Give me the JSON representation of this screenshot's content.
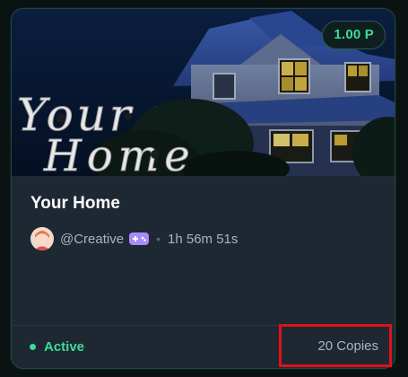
{
  "card": {
    "price": "1.00 P",
    "banner_art_text": "Your Home",
    "title": "Your Home",
    "creator": "@Creative",
    "timer": "1h 56m 51s",
    "separator": "•",
    "status": "Active",
    "copies": "20 Copies"
  },
  "colors": {
    "accent_green": "#3ddc97",
    "card_bg": "#1e2833",
    "highlight_red": "#e0101a",
    "gamepad_purple": "#a78bfa"
  },
  "icons": {
    "creator_badge": "gamepad-icon",
    "avatar": "avatar"
  }
}
